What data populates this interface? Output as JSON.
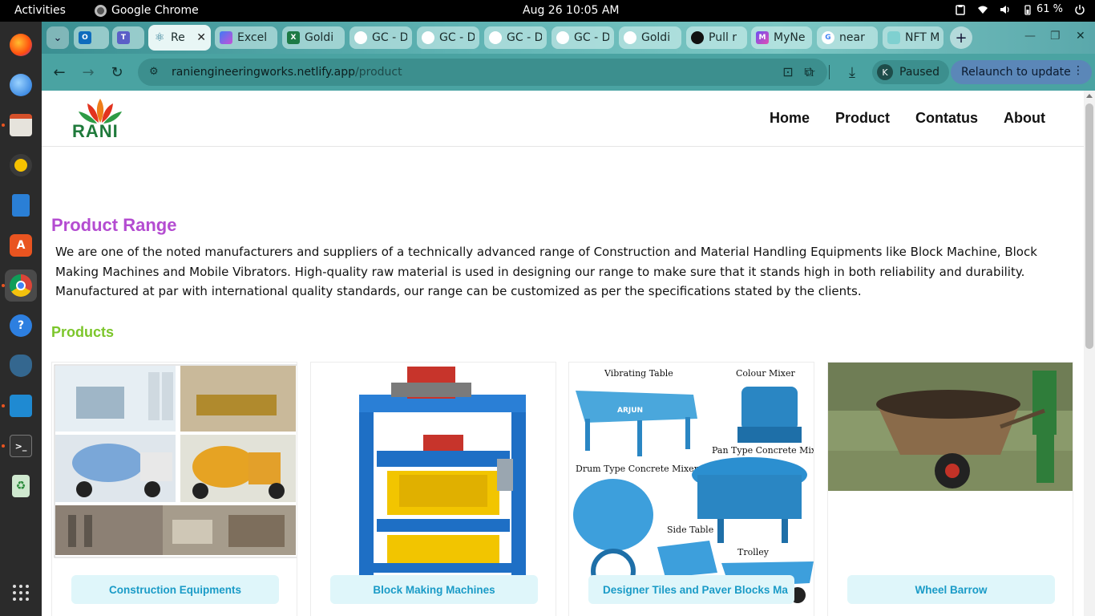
{
  "os": {
    "activities": "Activities",
    "app_name": "Google Chrome",
    "clock": "Aug 26  10:05 AM",
    "battery": "61 %"
  },
  "browser": {
    "tabs": [
      {
        "title": "",
        "favicon": "outlook-icon"
      },
      {
        "title": "",
        "favicon": "teams-icon"
      },
      {
        "title": "Re",
        "favicon": "react-icon",
        "active": true
      },
      {
        "title": "Excel",
        "favicon": "copilot-icon"
      },
      {
        "title": "Goldi",
        "favicon": "excel-icon"
      },
      {
        "title": "GC - D",
        "favicon": "goldi-icon"
      },
      {
        "title": "GC - D",
        "favicon": "goldi-icon"
      },
      {
        "title": "GC - D",
        "favicon": "goldi-icon"
      },
      {
        "title": "GC - D",
        "favicon": "goldi-icon"
      },
      {
        "title": "Goldi",
        "favicon": "goldi-icon"
      },
      {
        "title": "Pull r",
        "favicon": "github-icon"
      },
      {
        "title": "MyNe",
        "favicon": "myne-icon"
      },
      {
        "title": "near",
        "favicon": "google-icon"
      },
      {
        "title": "NFT M",
        "favicon": "nft-icon"
      }
    ],
    "url_domain": "raniengineeringworks.netlify.app",
    "url_path": "/product",
    "profile_initial": "K",
    "profile_status": "Paused",
    "relaunch_label": "Relaunch to update"
  },
  "site": {
    "brand": "RANI",
    "nav": [
      "Home",
      "Product",
      "Contatus",
      "About"
    ],
    "title": "Product Range",
    "intro": "We are one of the noted manufacturers and suppliers of a technically advanced range of Construction and Material Handling Equipments like Block Machine, Block Making Machines and Mobile Vibrators. High-quality raw material is used in designing our range to make sure that it stands high in both reliability and durability. Manufactured at par with international quality standards, our range can be customized as per the specifications stated by the clients.",
    "products_heading": "Products",
    "products": [
      {
        "label": "Construction Equipments"
      },
      {
        "label": "Block Making Machines"
      },
      {
        "label": "Designer Tiles and Paver Blocks Ma",
        "image_captions": [
          "Vibrating Table",
          "Colour Mixer",
          "Pan Type Concrete Mixer",
          "Drum Type Concrete Mixer",
          "Side Table",
          "Trolley"
        ],
        "brand_marks": [
          "ARJUN"
        ]
      },
      {
        "label": "Wheel Barrow"
      }
    ]
  },
  "colors": {
    "title": "#b44cd1",
    "products_heading": "#7cc62b",
    "card_label_bg": "#dff6fa",
    "card_label_text": "#1a9bc7",
    "toolbar": "#4aa3a2",
    "relaunch": "#5b87b8"
  }
}
